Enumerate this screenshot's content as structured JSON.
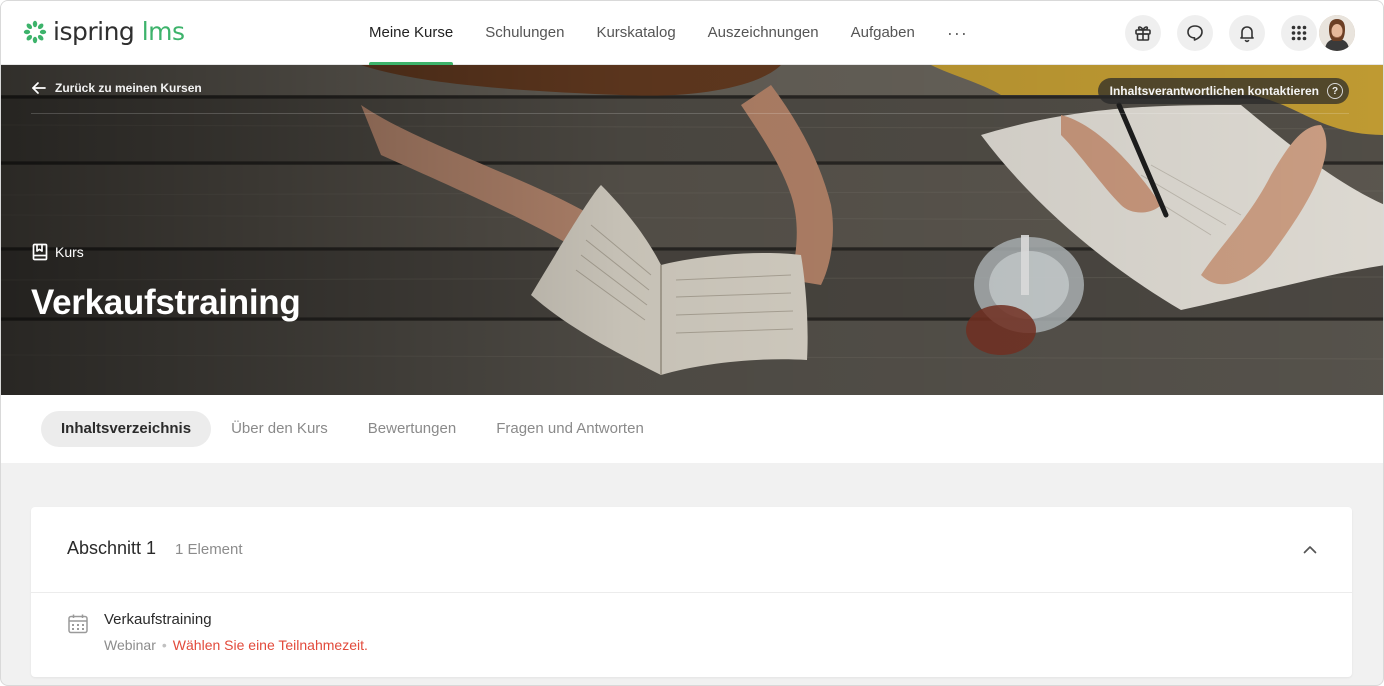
{
  "brand": {
    "name": "ispring",
    "product": "lms",
    "accent_color": "#3db36b"
  },
  "nav": {
    "items": [
      {
        "label": "Meine Kurse",
        "active": true
      },
      {
        "label": "Schulungen",
        "active": false
      },
      {
        "label": "Kurskatalog",
        "active": false
      },
      {
        "label": "Auszeichnungen",
        "active": false
      },
      {
        "label": "Aufgaben",
        "active": false
      }
    ],
    "more_label": "···"
  },
  "toolbar": {
    "icons": [
      "gift-icon",
      "chat-icon",
      "bell-icon",
      "apps-grid-icon",
      "user-avatar"
    ]
  },
  "hero": {
    "back_label": "Zurück zu meinen Kursen",
    "contact_label": "Inhaltsverantwortlichen kontaktieren",
    "help_glyph": "?",
    "kind_label": "Kurs",
    "title": "Verkaufstraining"
  },
  "tabs": [
    {
      "label": "Inhaltsverzeichnis",
      "active": true
    },
    {
      "label": "Über den Kurs",
      "active": false
    },
    {
      "label": "Bewertungen",
      "active": false
    },
    {
      "label": "Fragen und Antworten",
      "active": false
    }
  ],
  "section": {
    "title": "Abschnitt 1",
    "count": "1 Element",
    "expanded": true,
    "items": [
      {
        "title": "Verkaufstraining",
        "type": "Webinar",
        "separator": "•",
        "status": "Wählen Sie eine Teilnahmezeit.",
        "status_color": "#e24a3b",
        "icon": "calendar-icon"
      }
    ]
  }
}
